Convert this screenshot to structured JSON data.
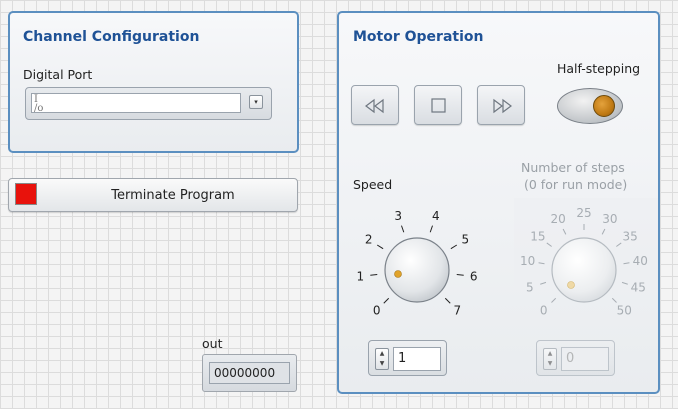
{
  "channel_config": {
    "title": "Channel Configuration",
    "digital_port_label": "Digital Port",
    "digital_port_value": ""
  },
  "terminate": {
    "label": "Terminate Program",
    "led_color": "#e8120c"
  },
  "out": {
    "label": "out",
    "value": "00000000"
  },
  "motor": {
    "title": "Motor Operation",
    "transport": [
      "rewind",
      "stop",
      "fast-forward"
    ],
    "half_stepping_label": "Half-stepping",
    "half_stepping_on": true,
    "speed_label": "Speed",
    "speed_ticks": [
      "0",
      "1",
      "2",
      "3",
      "4",
      "5",
      "6",
      "7"
    ],
    "speed_value": "1",
    "steps_label_line1": "Number of steps",
    "steps_label_line2": "(0 for run mode)",
    "steps_ticks": [
      "0",
      "5",
      "10",
      "15",
      "20",
      "25",
      "30",
      "35",
      "40",
      "45",
      "50"
    ],
    "steps_value": "0"
  },
  "colors": {
    "panel_border": "#5b8fc0",
    "title_blue": "#1f5296",
    "knob_dot": "#e1a32a"
  }
}
